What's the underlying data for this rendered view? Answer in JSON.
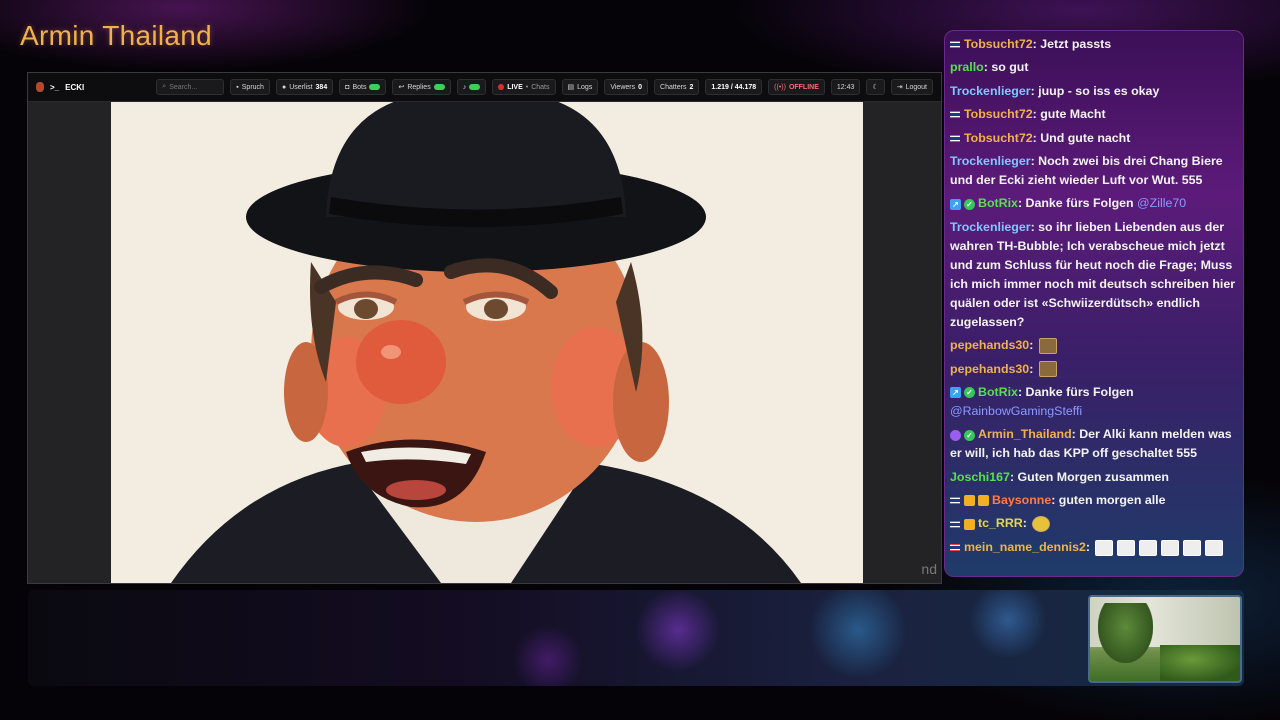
{
  "overlay": {
    "title": "Armin Thailand"
  },
  "topbar": {
    "brand": "ECKI",
    "search_placeholder": "Search...",
    "spruch_label": "Spruch",
    "userlist_label": "Userlist",
    "userlist_count": "384",
    "bots_label": "Bots",
    "replies_label": "Replies",
    "live_label": "LIVE",
    "chats_label": "Chats",
    "logs_label": "Logs",
    "viewers_label": "Viewers",
    "viewers_count": "0",
    "chatters_label": "Chatters",
    "chatters_count": "2",
    "followers_text": "1.219 / 44.178",
    "status_label": "OFFLINE",
    "time": "12:43",
    "logout_label": "Logout"
  },
  "video": {
    "watermark": "nd"
  },
  "chat": {
    "messages": [
      {
        "user": "Tobsucht72",
        "user_color": "#f0b24a",
        "flag": true,
        "text": ": Jetzt passts"
      },
      {
        "user": "prallo",
        "user_color": "#57e04f",
        "text": ": so gut"
      },
      {
        "user": "Trockenlieger",
        "user_color": "#7ec8ff",
        "text": ": juup - so iss es okay"
      },
      {
        "user": "Tobsucht72",
        "user_color": "#f0b24a",
        "flag": true,
        "text": ": gute Macht"
      },
      {
        "user": "Tobsucht72",
        "user_color": "#f0b24a",
        "flag": true,
        "text": ": Und gute nacht"
      },
      {
        "user": "Trockenlieger",
        "user_color": "#7ec8ff",
        "text": ": Noch zwei bis drei Chang Biere und der Ecki zieht wieder Luft vor Wut. 555"
      },
      {
        "user": "BotRix",
        "user_color": "#57e04f",
        "badges": [
          "bot",
          "verified"
        ],
        "text": ": Danke fürs Folgen ",
        "mention": "@Zille70"
      },
      {
        "user": "Trockenlieger",
        "user_color": "#7ec8ff",
        "text": ": so ihr lieben Liebenden aus der wahren TH-Bubble; Ich verabscheue mich jetzt und zum Schluss für heut noch die Frage; Muss ich mich immer noch mit deutsch schreiben hier quälen oder ist «Schwiizerdütsch» endlich zugelassen?"
      },
      {
        "user": "pepehands30",
        "user_color": "#f0b24a",
        "text": ": ",
        "emotes": [
          "brown"
        ]
      },
      {
        "user": "pepehands30",
        "user_color": "#f0b24a",
        "text": ": ",
        "emotes": [
          "brown"
        ]
      },
      {
        "user": "BotRix",
        "user_color": "#57e04f",
        "badges": [
          "bot",
          "verified"
        ],
        "text": ": Danke fürs Folgen ",
        "mention": "@RainbowGamingSteffi"
      },
      {
        "user": "Armin_Thailand",
        "user_color": "#f0b24a",
        "badges": [
          "purple",
          "verified"
        ],
        "text": ": Der Alki kann melden was er will, ich hab das KPP off geschaltet 555"
      },
      {
        "user": "Joschi167",
        "user_color": "#57e04f",
        "text": ": Guten Morgen zusammen"
      },
      {
        "user": "Baysonne",
        "user_color": "#ff7b4a",
        "flag": true,
        "badges": [
          "gold",
          "gold"
        ],
        "text": ": guten morgen alle"
      },
      {
        "user": "tc_RRR",
        "user_color": "#e6d84a",
        "flag": true,
        "badges": [
          "gold"
        ],
        "text": ": ",
        "emotes": [
          "yellow"
        ]
      },
      {
        "user": "mein_name_dennis2",
        "user_color": "#f0b24a",
        "flag": true,
        "text": ": ",
        "emotes": [
          "white",
          "white",
          "white",
          "white",
          "white",
          "white"
        ]
      }
    ]
  },
  "colors": {
    "accent_gold": "#f0b24a",
    "live_red": "#e02b2b",
    "toggle_green": "#3ecf5a"
  }
}
